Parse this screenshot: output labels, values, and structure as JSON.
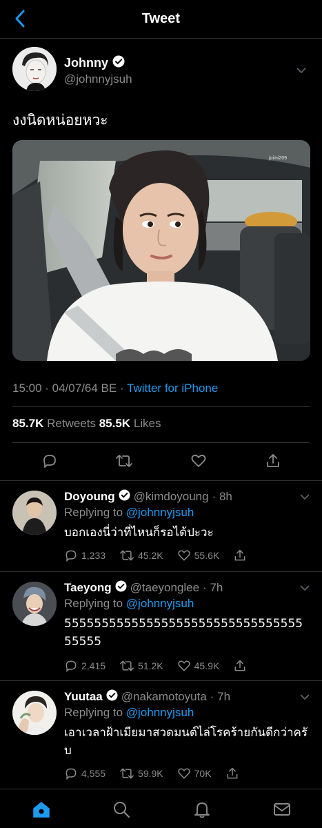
{
  "header": {
    "title": "Tweet"
  },
  "tweet": {
    "author_name": "Johnny",
    "author_handle": "@johnnyjsuh",
    "text": "งงนิดหน่อยหวะ",
    "time": "15:00 · 04/07/64 BE · ",
    "source": "Twitter for iPhone",
    "retweets": "85.7K",
    "retweets_label": "Retweets",
    "likes": "85.5K",
    "likes_label": "Likes",
    "media_watermark": "joimi209"
  },
  "replies": [
    {
      "name": "Doyoung",
      "handle": "@kimdoyoung",
      "age": "· 8h",
      "replying_label": "Replying to ",
      "replying_to": "@johnnyjsuh",
      "text": "บอกเองนี่ว่าที่ไหนก็รอได้ปะวะ",
      "replies": "1,233",
      "retweets": "45.2K",
      "likes": "55.6K"
    },
    {
      "name": "Taeyong",
      "handle": "@taeyonglee",
      "age": "· 7h",
      "replying_label": "Replying to ",
      "replying_to": "@johnnyjsuh",
      "text": "5555555555555555555555555555555555555",
      "replies": "2,415",
      "retweets": "51.2K",
      "likes": "45.9K"
    },
    {
      "name": "Yuutaa",
      "handle": "@nakamotoyuta",
      "age": "· 7h",
      "replying_label": "Replying to ",
      "replying_to": "@johnnyjsuh",
      "text": "เอาเวลาฝ้าเมียมาสวดมนต์ไล่โรคร้ายกันดีกว่าครับ",
      "replies": "4,555",
      "retweets": "59.9K",
      "likes": "70K"
    }
  ],
  "colors": {
    "accent": "#1d9bf0",
    "background": "#000000",
    "muted": "#8b8b8b"
  },
  "icons": [
    "back-arrow-icon",
    "verified-badge-icon",
    "chevron-down-icon",
    "reply-icon",
    "retweet-icon",
    "like-icon",
    "share-icon",
    "home-icon",
    "search-icon",
    "notifications-icon",
    "messages-icon"
  ]
}
